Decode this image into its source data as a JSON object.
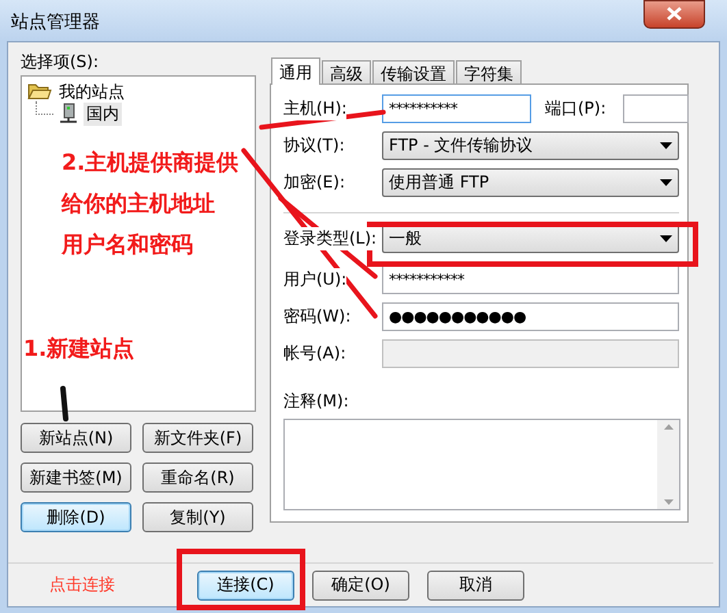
{
  "window": {
    "title": "站点管理器"
  },
  "tree": {
    "label": "选择项(S):",
    "items": [
      {
        "label": "我的站点",
        "expanded": true,
        "selected": false,
        "children": [
          {
            "label": "国内",
            "selected": true
          }
        ]
      }
    ]
  },
  "site_buttons": [
    {
      "label": "新站点(N)",
      "focused": false
    },
    {
      "label": "新文件夹(F)",
      "focused": false
    },
    {
      "label": "新建书签(M)",
      "focused": false
    },
    {
      "label": "重命名(R)",
      "focused": false
    },
    {
      "label": "删除(D)",
      "focused": true
    },
    {
      "label": "复制(Y)",
      "focused": false
    }
  ],
  "tabs": [
    {
      "label": "通用",
      "selected": true
    },
    {
      "label": "高级",
      "selected": false
    },
    {
      "label": "传输设置",
      "selected": false
    },
    {
      "label": "字符集",
      "selected": false
    }
  ],
  "general": {
    "host": {
      "label": "主机(H):",
      "value": "**********"
    },
    "port": {
      "label": "端口(P):"
    },
    "fields": [
      {
        "kind": "select",
        "label": "协议(T):",
        "value": "FTP - 文件传输协议",
        "disabled": false
      },
      {
        "kind": "select",
        "label": "加密(E):",
        "value": "使用普通 FTP",
        "disabled": false
      }
    ],
    "login_fields": [
      {
        "kind": "select",
        "label": "登录类型(L):",
        "value": "一般",
        "disabled": false
      },
      {
        "kind": "text",
        "label": "用户(U):",
        "value": "***********",
        "disabled": false
      },
      {
        "kind": "text",
        "label": "密码(W):",
        "value": "●●●●●●●●●●●",
        "disabled": false
      },
      {
        "kind": "text",
        "label": "帐号(A):",
        "disabled": true
      }
    ],
    "comment": {
      "label": "注释(M):"
    }
  },
  "footer": {
    "hint": "点击连接",
    "buttons": [
      {
        "label": "连接(C)",
        "focused": true
      },
      {
        "label": "确定(O)",
        "focused": false
      },
      {
        "label": "取消",
        "focused": false
      }
    ]
  },
  "annotations": {
    "step_2": [
      "2.主机提供商提供",
      "给你的主机地址",
      "用户名和密码"
    ],
    "step_1": "1.新建站点"
  }
}
